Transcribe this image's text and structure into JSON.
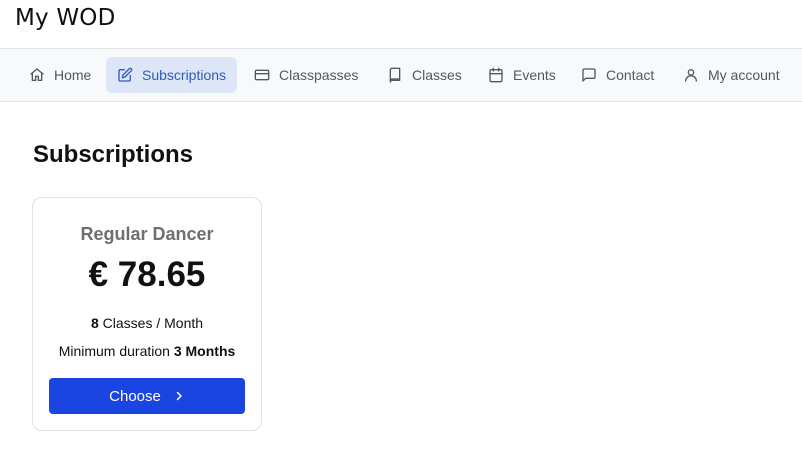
{
  "app": {
    "title": "My WOD"
  },
  "nav": {
    "items": [
      {
        "label": "Home",
        "icon": "home-icon"
      },
      {
        "label": "Subscriptions",
        "icon": "edit-icon",
        "active": true
      },
      {
        "label": "Classpasses",
        "icon": "credit-card-icon"
      },
      {
        "label": "Classes",
        "icon": "book-icon"
      },
      {
        "label": "Events",
        "icon": "calendar-icon"
      },
      {
        "label": "Contact",
        "icon": "message-icon"
      },
      {
        "label": "My account",
        "icon": "user-icon"
      }
    ]
  },
  "page": {
    "title": "Subscriptions"
  },
  "subscription": {
    "name": "Regular Dancer",
    "price": "€ 78.65",
    "classes_count": "8",
    "classes_unit": "Classes / Month",
    "duration_prefix": "Minimum duration",
    "duration_value": "3 Months",
    "button_label": "Choose"
  },
  "colors": {
    "accent": "#1a45e0",
    "active_nav_bg": "#dde6f7",
    "active_nav_text": "#2d5bbf",
    "navbar_bg": "#f8f9fa"
  }
}
